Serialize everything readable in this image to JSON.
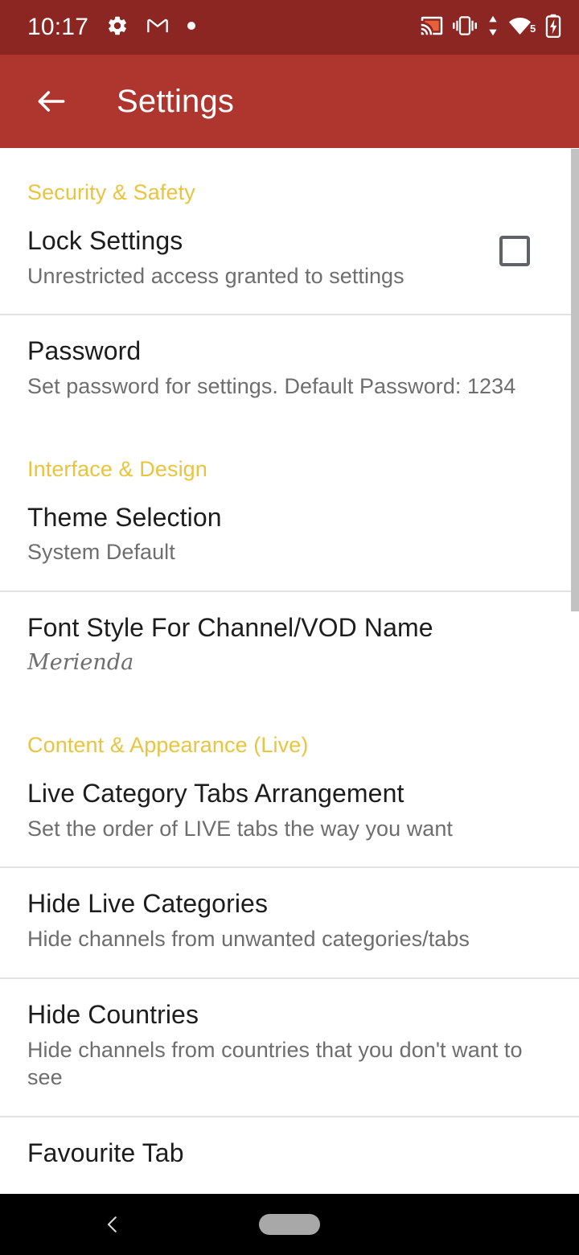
{
  "status_bar": {
    "time": "10:17",
    "left_icons": [
      "gear-icon",
      "gmail-icon",
      "dot-icon"
    ],
    "right_icons": [
      "cast-icon",
      "vibrate-icon",
      "data-transfer-icon",
      "wifi-5-icon",
      "battery-charging-icon"
    ],
    "wifi_band_label": "5",
    "background_color": "#8B2622"
  },
  "app_bar": {
    "title": "Settings",
    "back_icon": "arrow-left-icon",
    "background_color": "#AE362E"
  },
  "theme": {
    "accent_header_color": "#E8C43F",
    "title_color": "#1D1D1D",
    "summary_color": "#6E6E6E",
    "divider_color": "#E2E2E2",
    "checkbox_border_color": "#5F6368"
  },
  "settings": [
    {
      "type": "group",
      "header": "Security & Safety",
      "items": [
        {
          "title": "Lock Settings",
          "summary": "Unrestricted access granted to settings",
          "control": "checkbox",
          "checked": false,
          "divider_after": true
        },
        {
          "title": "Password",
          "summary": "Set password for settings. Default Password: 1234",
          "control": "none",
          "divider_after": false
        }
      ]
    },
    {
      "type": "group",
      "header": "Interface & Design",
      "items": [
        {
          "title": "Theme Selection",
          "summary": "System Default",
          "control": "none",
          "divider_after": true
        },
        {
          "title": "Font Style For Channel/VOD Name",
          "summary": "Merienda",
          "summary_styled": true,
          "control": "none",
          "divider_after": false
        }
      ]
    },
    {
      "type": "group",
      "header": "Content & Appearance (Live)",
      "items": [
        {
          "title": "Live Category Tabs Arrangement",
          "summary": "Set the order of LIVE tabs the way you want",
          "control": "none",
          "divider_after": true
        },
        {
          "title": "Hide Live Categories",
          "summary": "Hide channels from unwanted categories/tabs",
          "control": "none",
          "divider_after": true
        },
        {
          "title": "Hide Countries",
          "summary": "Hide channels from countries that you don't want to see",
          "control": "none",
          "divider_after": true
        },
        {
          "title": "Favourite Tab",
          "summary": "",
          "control": "none",
          "divider_after": false
        }
      ]
    }
  ],
  "nav_bar": {
    "back_icon": "chevron-left-icon",
    "home_icon": "home-pill-icon",
    "background_color": "#000000"
  }
}
